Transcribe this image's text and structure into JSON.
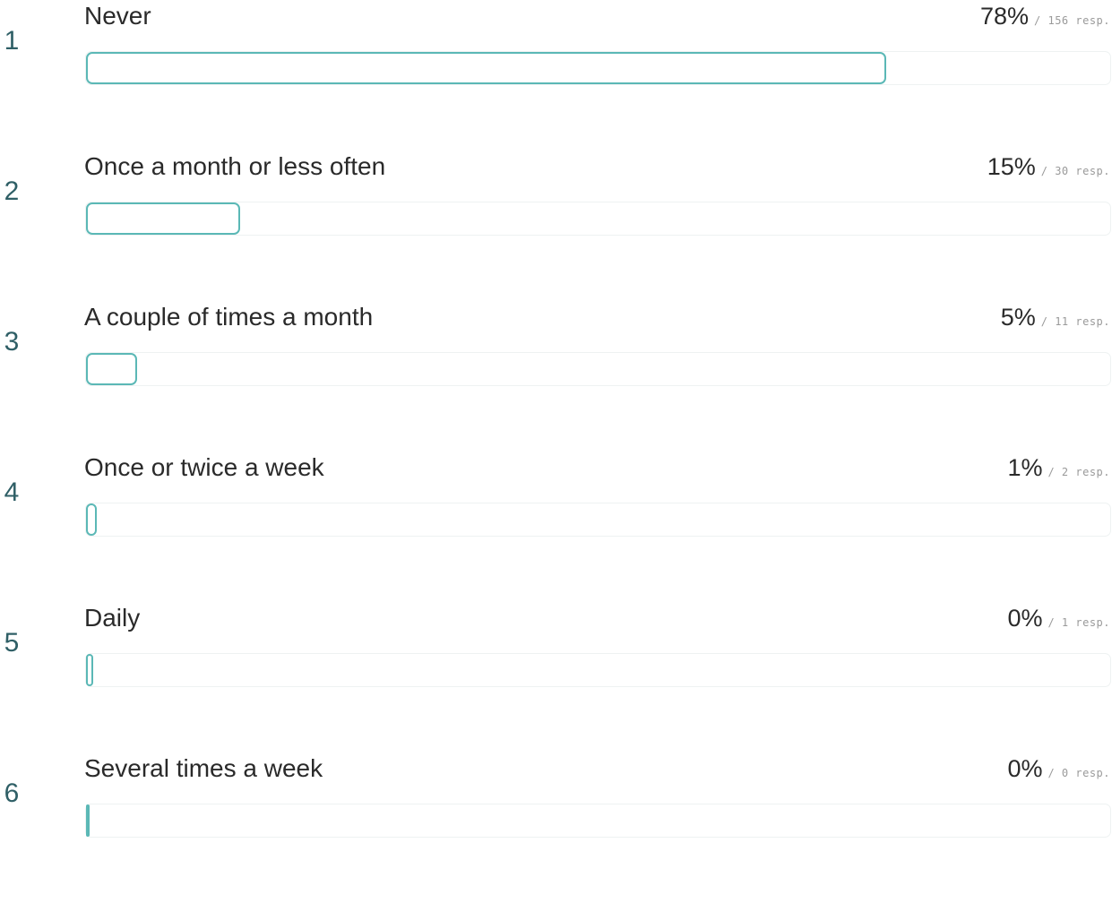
{
  "chart_data": {
    "type": "bar",
    "orientation": "horizontal",
    "categories": [
      "Never",
      "Once a month or less often",
      "A couple of times a month",
      "Once or twice a week",
      "Daily",
      "Several times a week"
    ],
    "ranks": [
      "1",
      "2",
      "3",
      "4",
      "5",
      "6"
    ],
    "values": [
      78,
      15,
      5,
      1,
      0,
      0
    ],
    "responses": [
      156,
      30,
      11,
      2,
      1,
      0
    ],
    "value_labels": [
      "78%",
      "15%",
      "5%",
      "1%",
      "0%",
      "0%"
    ],
    "response_labels": [
      "/ 156 resp.",
      "/ 30 resp.",
      "/ 11 resp.",
      "/ 2 resp.",
      "/ 1 resp.",
      "/ 0 resp."
    ],
    "xlim": [
      0,
      100
    ],
    "colors": {
      "bar": "#5bb8b6",
      "rank": "#2f5f66",
      "text": "#2a2a2a"
    }
  }
}
